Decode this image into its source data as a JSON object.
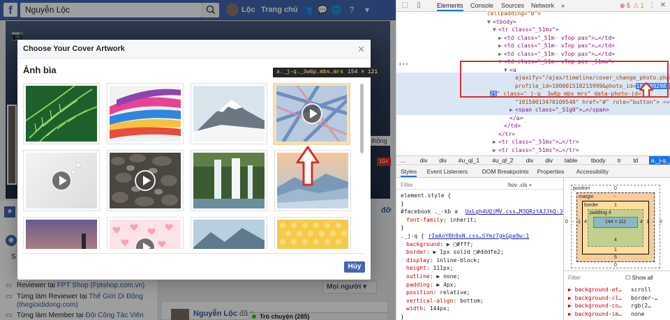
{
  "facebook": {
    "search_value": "Nguyễn Lộc",
    "user_name": "Lộc",
    "home_label": "Trang chủ",
    "side_tag": "thông",
    "side_badge": "10+",
    "side_tail": "đỡ",
    "left_s": "S",
    "work_rows": [
      {
        "prefix": "Reviewer tại ",
        "link": "FPT Shop (Fptshop.com.vn)"
      },
      {
        "prefix": "Từng làm Reviewer tại ",
        "link": "Thế Giới Di Động"
      },
      {
        "prefix": "",
        "link": "(thegioididong.com)"
      },
      {
        "prefix": "Từng làm Member tại ",
        "link": "Đội Công Tác Viên"
      }
    ],
    "privacy_button": "Mọi người ▾",
    "post_name": "Nguyễn Lộc",
    "post_rest": " đã c",
    "chat_label": "Trò chuyện (285)"
  },
  "modal": {
    "title": "Choose Your Cover Artwork",
    "close_icon": "close-icon",
    "section_title": "Ảnh bìa",
    "cancel_label": "Hủy",
    "tooltip": {
      "selector": "a._j-q._3w6p.mbs.mrs",
      "dims": "154 × 121"
    },
    "thumbs": [
      {
        "name": "fern",
        "video": false
      },
      {
        "name": "paint-streaks",
        "video": false
      },
      {
        "name": "snow-mountain",
        "video": false
      },
      {
        "name": "blue-stripes",
        "video": true,
        "selected": true
      },
      {
        "name": "white-bubbles",
        "video": true
      },
      {
        "name": "pebbles",
        "video": true
      },
      {
        "name": "waterfall",
        "video": false
      },
      {
        "name": "misty-mountain",
        "video": false
      },
      {
        "name": "lighthouse",
        "video": false
      },
      {
        "name": "pink-hearts",
        "video": true
      },
      {
        "name": "mountain-lake",
        "video": false
      },
      {
        "name": "yellow-dots",
        "video": false
      }
    ]
  },
  "devtools": {
    "tabs": [
      "Elements",
      "Console",
      "Sources",
      "Network"
    ],
    "active_tab": "Elements",
    "error_count": "5",
    "warning_count": "1",
    "dom_lines": [
      {
        "indent": 0,
        "arrow": "",
        "text": "cellpadding=\"0\">"
      },
      {
        "indent": 1,
        "arrow": "▼",
        "text": "<tbody>"
      },
      {
        "indent": 2,
        "arrow": "▼",
        "text": "<tr class=\"_51mx\">"
      },
      {
        "indent": 3,
        "arrow": "▶",
        "text": "<td class=\"_51m- vTop pas\">…</td>"
      },
      {
        "indent": 3,
        "arrow": "▶",
        "text": "<td class=\"_51m- vTop pas\">…</td>"
      },
      {
        "indent": 3,
        "arrow": "▶",
        "text": "<td class=\"_51m- vTop pas\">…</td>"
      },
      {
        "indent": 3,
        "arrow": "▼",
        "text": "<td class=\"_51m- vTop pas _51mw\">"
      },
      {
        "indent": 4,
        "arrow": "▼",
        "text": "<a"
      },
      {
        "indent": 5,
        "arrow": "",
        "text": "ajaxify=\"/ajax/timeline/cover_change_photo.php?"
      },
      {
        "indent": 5,
        "arrow": "",
        "text": "profile_id=100001518215999&photo_id="
      },
      {
        "indent": 5,
        "arrow": "",
        "text": "\" class=\"_j-q _3w6p mbs mrs\" data-photo-id="
      },
      {
        "indent": 5,
        "arrow": "",
        "text": "\"10150013470109548\" href=\"#\" role=\"button\">"
      },
      {
        "indent": 5,
        "arrow": "▶",
        "text": "<span class=\"_51g0\">…</span>"
      },
      {
        "indent": 4,
        "arrow": "",
        "text": "</a>"
      },
      {
        "indent": 3,
        "arrow": "",
        "text": "</td>"
      },
      {
        "indent": 2,
        "arrow": "",
        "text": "</tr>"
      },
      {
        "indent": 2,
        "arrow": "▶",
        "text": "<tr class=\"_51mx\">…</tr>"
      },
      {
        "indent": 2,
        "arrow": "▶",
        "text": "<tr class=\"_51mx\">…</tr>"
      },
      {
        "indent": 2,
        "arrow": "▶",
        "text": "<tr class=\"_51mx\">…</tr>"
      }
    ],
    "highlight_text_a": "18008929833046",
    "highlight_text_b": "25",
    "dom_eq": "== $0",
    "breadcrumbs": [
      "...",
      "div",
      "div",
      "#u_ql_1",
      "#u_ql_2",
      "div",
      "div",
      "table",
      "tbody",
      "tr",
      "td",
      "a._j-q._3w6p.mbs.mrs"
    ],
    "subtabs": [
      "Styles",
      "Event Listeners",
      "DOM Breakpoints",
      "Properties",
      "Accessibility"
    ],
    "filter_label": "Filter",
    "filter_hov": ":hov  .cls  +",
    "styles": [
      {
        "type": "sel",
        "text": "element.style {"
      },
      {
        "type": "close",
        "text": "}"
      },
      {
        "type": "sel",
        "text": "#facebook ._-kb a ",
        "link": "UxLgh4UQjMV.css…M3QRztAJJhQ:30"
      },
      {
        "type": "prop",
        "p": "font-family",
        "v": "inherit;"
      },
      {
        "type": "close",
        "text": "}"
      },
      {
        "type": "sel",
        "text": "._j-q {",
        "link": "rIeAnYRh9xN.css…SYmz7gkGpa9w:1"
      },
      {
        "type": "prop",
        "p": "background",
        "v": "▶ □#fff;"
      },
      {
        "type": "prop",
        "p": "border",
        "v": "▶ 1px solid □#dddfe2;"
      },
      {
        "type": "prop",
        "p": "display",
        "v": "inline-block;"
      },
      {
        "type": "prop",
        "p": "height",
        "v": "111px;"
      },
      {
        "type": "prop",
        "p": "outline",
        "v": "▶ none;"
      },
      {
        "type": "prop",
        "p": "padding",
        "v": "▶ 4px;"
      },
      {
        "type": "prop",
        "p": "position",
        "v": "relative;"
      },
      {
        "type": "prop",
        "p": "vertical-align",
        "v": "bottom;"
      },
      {
        "type": "prop",
        "p": "width",
        "v": "144px;"
      },
      {
        "type": "close",
        "text": "}"
      }
    ],
    "boxmodel": {
      "position_label": "position",
      "position_value": "0",
      "margin_label": "margin",
      "margin_value": "-",
      "border_label": "border",
      "border_value": "1",
      "padding_label": "padding 4",
      "content": "144 × 111",
      "left_outer": "0",
      "left_margin": "-",
      "left_border": "1",
      "left_padding": "4",
      "right_padding": "4",
      "right_border": "1",
      "right_margin": "-",
      "right_outer": "0",
      "bottom_padding": "4",
      "bottom_border": "1",
      "bottom_margin": "5",
      "bottom_outer": "0"
    },
    "computed_filter": "Filter",
    "show_all": "Show all",
    "computed": [
      {
        "p": "background-at…",
        "v": "scroll"
      },
      {
        "p": "background-cl…",
        "v": "border-…"
      },
      {
        "p": "background-co…",
        "v": "rgb(2…"
      },
      {
        "p": "background-im…",
        "v": "none"
      }
    ]
  },
  "colors": {
    "fb_blue": "#4267b2",
    "devtools_accent": "#1a73e8",
    "annotation_red": "#d62e2e"
  }
}
